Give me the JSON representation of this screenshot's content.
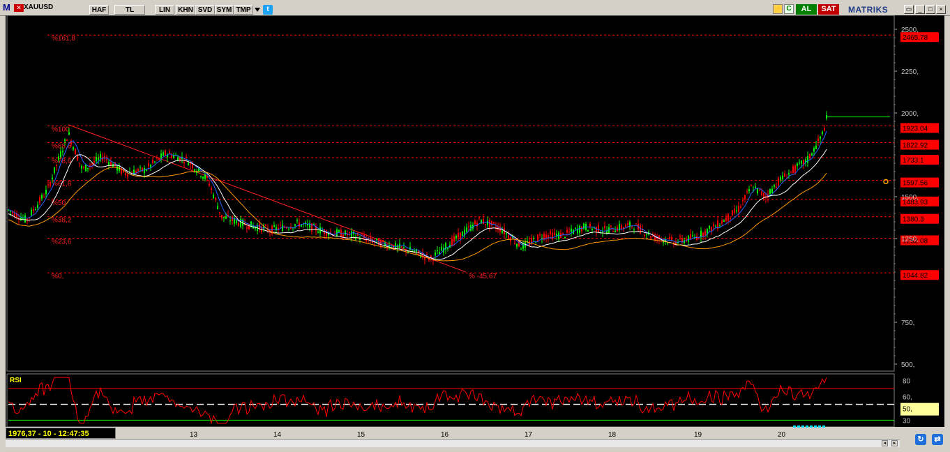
{
  "toolbar": {
    "logo": "M",
    "symbol": "XAUUSD",
    "buttons": [
      "HAF",
      "TL",
      "LIN",
      "KHN",
      "SVD",
      "SYM",
      "TMP"
    ],
    "buy_label": "AL",
    "sell_label": "SAT",
    "brand": "MATRIKS"
  },
  "fibonacci": {
    "levels": [
      {
        "label": "%161,8",
        "price_label": "2465.78",
        "price": 2465.78
      },
      {
        "label": "%100",
        "price_label": "1923.04",
        "price": 1923.04
      },
      {
        "label": "%88,6",
        "price_label": "1822.92",
        "price": 1822.92
      },
      {
        "label": "%78,6",
        "price_label": "1733.1",
        "price": 1733.1
      },
      {
        "label": "%61,8",
        "price_label": "1597.56",
        "price": 1597.56
      },
      {
        "label": "%50",
        "price_label": "1483.93",
        "price": 1483.93
      },
      {
        "label": "%38,2",
        "price_label": "1380.3",
        "price": 1380.3
      },
      {
        "label": "%23,6",
        "price_label": "1252.08",
        "price": 1252.08
      },
      {
        "label": "%0,",
        "price_label": "1044.82",
        "price": 1044.82
      }
    ],
    "extension_label": "% -45,67"
  },
  "price_axis": {
    "ticks": [
      "2500,",
      "2250,",
      "2000,",
      "1500,",
      "1250,",
      "750,",
      "500,"
    ],
    "tick_values": [
      2500,
      2250,
      2000,
      1500,
      1250,
      750,
      500
    ],
    "current_price": 1976.37
  },
  "rsi": {
    "title": "RSI",
    "ticks": [
      "80",
      "60,",
      "30"
    ],
    "tick_values": [
      80,
      60,
      30
    ],
    "current_label": "50,",
    "current_value": 50
  },
  "status": {
    "text": "1976,37 - 10 - 12:47:35"
  },
  "date_axis": [
    "13",
    "14",
    "15",
    "16",
    "17",
    "18",
    "19",
    "20"
  ],
  "colors": {
    "up_candle": "#00ff00",
    "down_candle": "#ff0000",
    "fib_line": "#ff0000",
    "ma_fast": "#2266ff",
    "ma_mid": "#ffffff",
    "ma_slow": "#ff9900",
    "rsi_line": "#ff0000"
  }
}
